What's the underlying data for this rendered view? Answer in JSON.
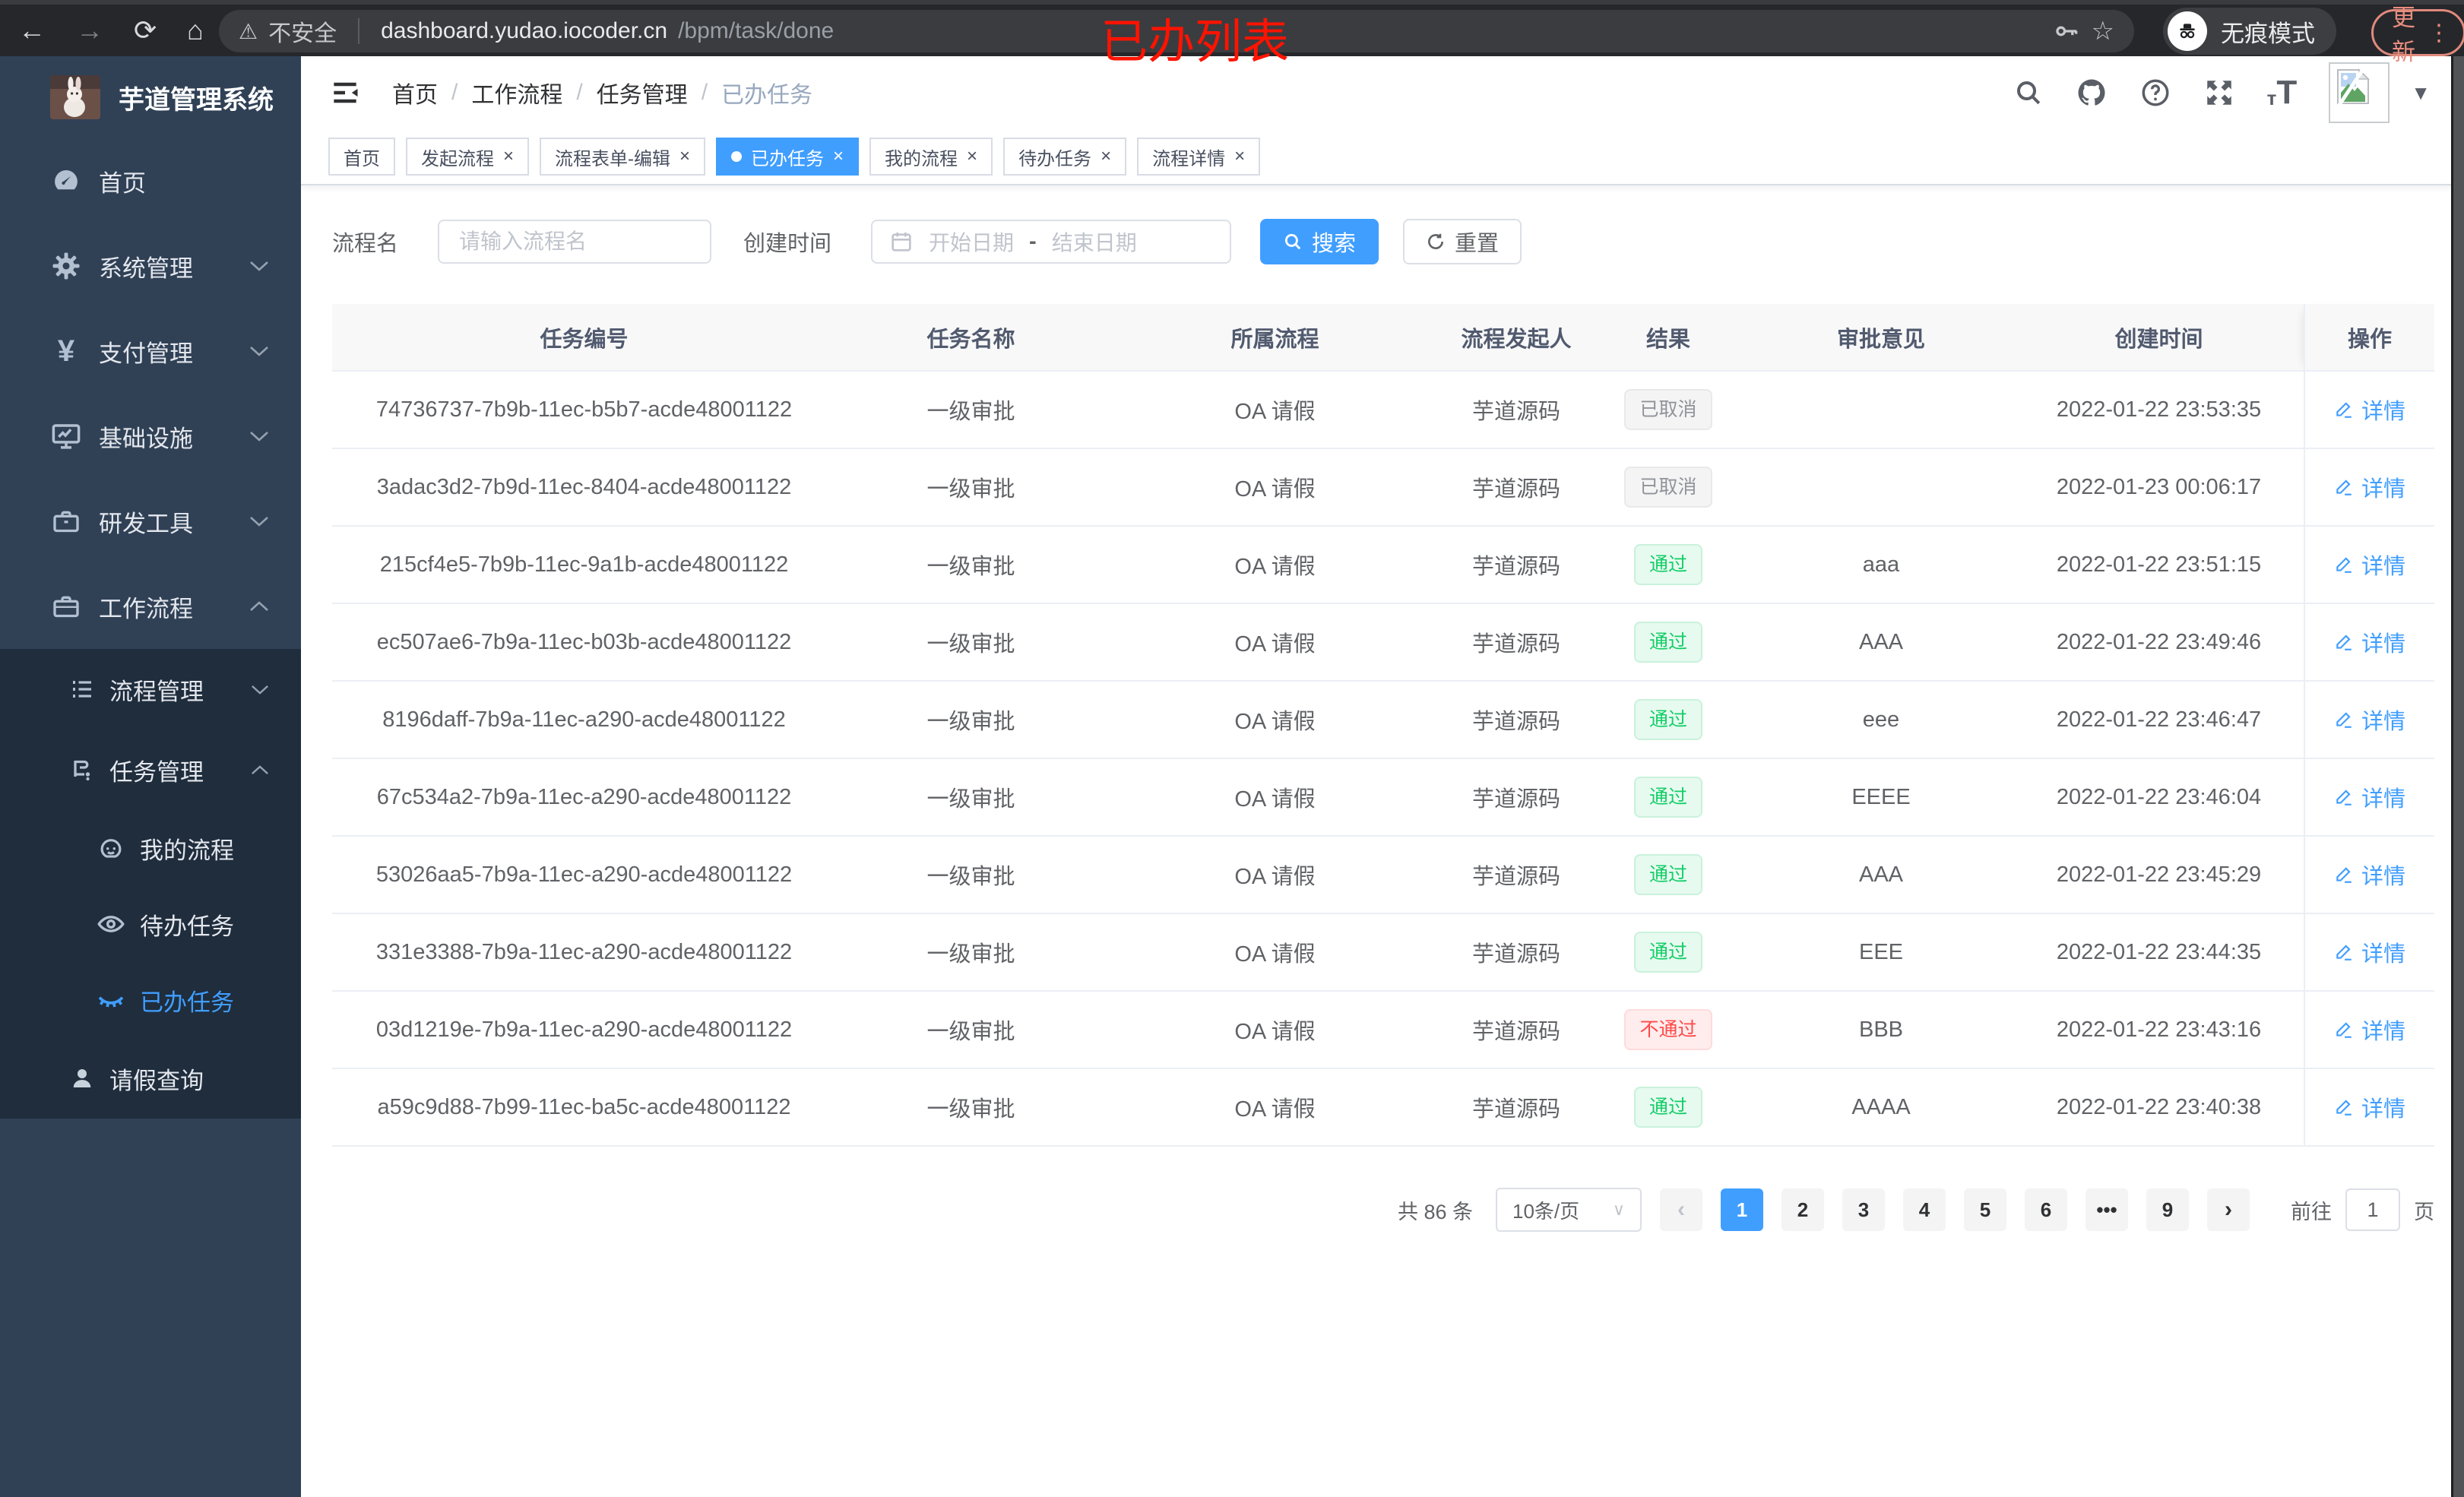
{
  "browser": {
    "security_label": "不安全",
    "url_host": "dashboard.yudao.iocoder.cn",
    "url_path": "/bpm/task/done",
    "incognito_label": "无痕模式",
    "update_label": "更新"
  },
  "annotation": {
    "text": "已办列表",
    "color": "#fe1301"
  },
  "sidebar": {
    "title": "芋道管理系统",
    "items": {
      "home": "首页",
      "system": "系统管理",
      "pay": "支付管理",
      "infra": "基础设施",
      "dev": "研发工具",
      "workflow": "工作流程",
      "process_mgmt": "流程管理",
      "task_mgmt": "任务管理",
      "my_process": "我的流程",
      "todo": "待办任务",
      "done": "已办任务",
      "leave": "请假查询"
    }
  },
  "header": {
    "breadcrumb": [
      "首页",
      "工作流程",
      "任务管理",
      "已办任务"
    ]
  },
  "tabs": [
    {
      "label": "首页",
      "cls": "no-close"
    },
    {
      "label": "发起流程",
      "cls": ""
    },
    {
      "label": "流程表单-编辑",
      "cls": ""
    },
    {
      "label": "已办任务",
      "cls": "active"
    },
    {
      "label": "我的流程",
      "cls": ""
    },
    {
      "label": "待办任务",
      "cls": ""
    },
    {
      "label": "流程详情",
      "cls": ""
    }
  ],
  "filter": {
    "name_label": "流程名",
    "name_placeholder": "请输入流程名",
    "time_label": "创建时间",
    "start_placeholder": "开始日期",
    "range_separator": "-",
    "end_placeholder": "结束日期",
    "search_label": "搜索",
    "reset_label": "重置"
  },
  "table": {
    "columns": [
      "任务编号",
      "任务名称",
      "所属流程",
      "流程发起人",
      "结果",
      "审批意见",
      "创建时间",
      "操作"
    ],
    "rows": [
      {
        "id": "74736737-7b9b-11ec-b5b7-acde48001122",
        "name": "一级审批",
        "flow": "OA 请假",
        "starter": "芋道源码",
        "result": "已取消",
        "rtype": "info",
        "comment": "",
        "time": "2022-01-22 23:53:35",
        "action": "详情"
      },
      {
        "id": "3adac3d2-7b9d-11ec-8404-acde48001122",
        "name": "一级审批",
        "flow": "OA 请假",
        "starter": "芋道源码",
        "result": "已取消",
        "rtype": "info",
        "comment": "",
        "time": "2022-01-23 00:06:17",
        "action": "详情"
      },
      {
        "id": "215cf4e5-7b9b-11ec-9a1b-acde48001122",
        "name": "一级审批",
        "flow": "OA 请假",
        "starter": "芋道源码",
        "result": "通过",
        "rtype": "success",
        "comment": "aaa",
        "time": "2022-01-22 23:51:15",
        "action": "详情"
      },
      {
        "id": "ec507ae6-7b9a-11ec-b03b-acde48001122",
        "name": "一级审批",
        "flow": "OA 请假",
        "starter": "芋道源码",
        "result": "通过",
        "rtype": "success",
        "comment": "AAA",
        "time": "2022-01-22 23:49:46",
        "action": "详情"
      },
      {
        "id": "8196daff-7b9a-11ec-a290-acde48001122",
        "name": "一级审批",
        "flow": "OA 请假",
        "starter": "芋道源码",
        "result": "通过",
        "rtype": "success",
        "comment": "eee",
        "time": "2022-01-22 23:46:47",
        "action": "详情"
      },
      {
        "id": "67c534a2-7b9a-11ec-a290-acde48001122",
        "name": "一级审批",
        "flow": "OA 请假",
        "starter": "芋道源码",
        "result": "通过",
        "rtype": "success",
        "comment": "EEEE",
        "time": "2022-01-22 23:46:04",
        "action": "详情"
      },
      {
        "id": "53026aa5-7b9a-11ec-a290-acde48001122",
        "name": "一级审批",
        "flow": "OA 请假",
        "starter": "芋道源码",
        "result": "通过",
        "rtype": "success",
        "comment": "AAA",
        "time": "2022-01-22 23:45:29",
        "action": "详情"
      },
      {
        "id": "331e3388-7b9a-11ec-a290-acde48001122",
        "name": "一级审批",
        "flow": "OA 请假",
        "starter": "芋道源码",
        "result": "通过",
        "rtype": "success",
        "comment": "EEE",
        "time": "2022-01-22 23:44:35",
        "action": "详情"
      },
      {
        "id": "03d1219e-7b9a-11ec-a290-acde48001122",
        "name": "一级审批",
        "flow": "OA 请假",
        "starter": "芋道源码",
        "result": "不通过",
        "rtype": "danger",
        "comment": "BBB",
        "time": "2022-01-22 23:43:16",
        "action": "详情"
      },
      {
        "id": "a59c9d88-7b99-11ec-ba5c-acde48001122",
        "name": "一级审批",
        "flow": "OA 请假",
        "starter": "芋道源码",
        "result": "通过",
        "rtype": "success",
        "comment": "AAAA",
        "time": "2022-01-22 23:40:38",
        "action": "详情"
      }
    ]
  },
  "pagination": {
    "total_label": "共 86 条",
    "page_size": "10条/页",
    "pages": [
      {
        "label": "1",
        "cls": "active"
      },
      {
        "label": "2",
        "cls": ""
      },
      {
        "label": "3",
        "cls": ""
      },
      {
        "label": "4",
        "cls": ""
      },
      {
        "label": "5",
        "cls": ""
      },
      {
        "label": "6",
        "cls": ""
      },
      {
        "label": "•••",
        "cls": ""
      },
      {
        "label": "9",
        "cls": ""
      }
    ],
    "goto_label": "前往",
    "goto_value": "1",
    "page_unit": "页"
  },
  "colors": {
    "primary": "#409eff",
    "success": "#13ce66",
    "danger": "#ff4949",
    "info": "#909399",
    "sidebar": "#304156",
    "submenu": "#1f2d3d"
  }
}
